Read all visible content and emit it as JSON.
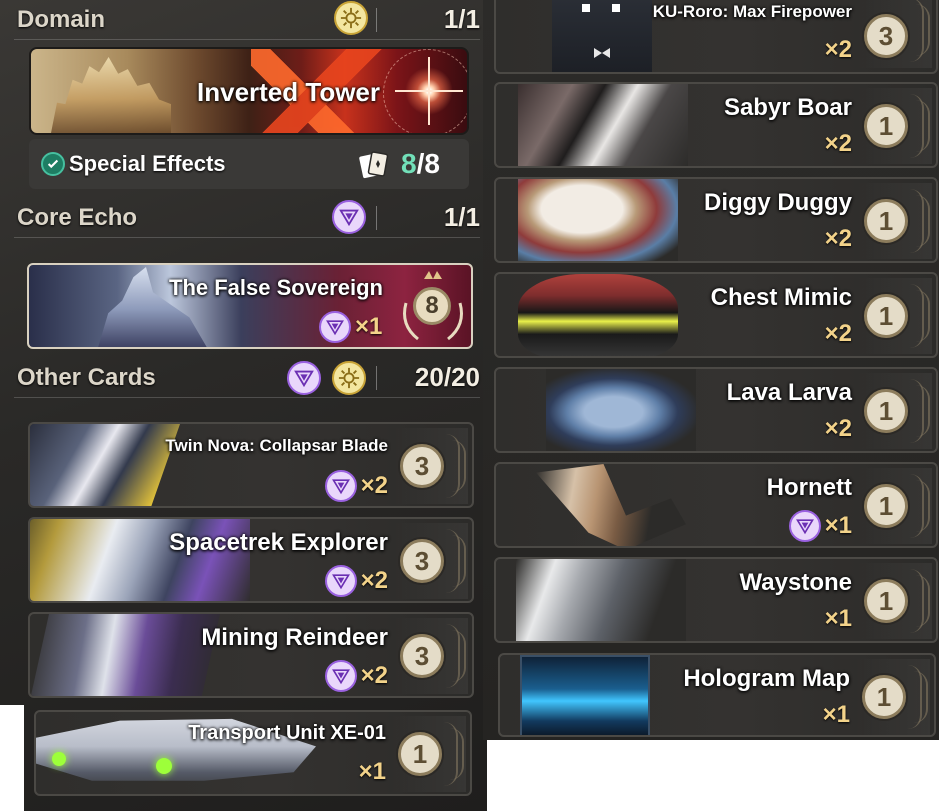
{
  "domain_section": {
    "title": "Domain",
    "count": "1/1",
    "banner_name": "Inverted Tower",
    "special_effects_label": "Special Effects",
    "special_effects_current": "8",
    "special_effects_total": "/8"
  },
  "core_echo_section": {
    "title": "Core Echo",
    "count": "1/1",
    "card": {
      "name": "The False Sovereign",
      "cost": "8",
      "quantity": "×1"
    }
  },
  "other_cards_section": {
    "title": "Other Cards",
    "count": "20/20"
  },
  "left_cards": [
    {
      "name": "Twin Nova: Collapsar Blade",
      "quantity": "×2",
      "cost": "3",
      "echo": true
    },
    {
      "name": "Spacetrek Explorer",
      "quantity": "×2",
      "cost": "3",
      "echo": true
    },
    {
      "name": "Mining Reindeer",
      "quantity": "×2",
      "cost": "3",
      "echo": true
    },
    {
      "name": "Transport Unit XE-01",
      "quantity": "×1",
      "cost": "1",
      "echo": false
    }
  ],
  "right_cards": [
    {
      "name": "KU-Roro: Max Firepower",
      "quantity": "×2",
      "cost": "3",
      "echo": false
    },
    {
      "name": "Sabyr Boar",
      "quantity": "×2",
      "cost": "1",
      "echo": false
    },
    {
      "name": "Diggy Duggy",
      "quantity": "×2",
      "cost": "1",
      "echo": false
    },
    {
      "name": "Chest Mimic",
      "quantity": "×2",
      "cost": "1",
      "echo": false
    },
    {
      "name": "Lava Larva",
      "quantity": "×2",
      "cost": "1",
      "echo": false
    },
    {
      "name": "Hornett",
      "quantity": "×1",
      "cost": "1",
      "echo": true
    },
    {
      "name": "Waystone",
      "quantity": "×1",
      "cost": "1",
      "echo": false
    },
    {
      "name": "Hologram Map",
      "quantity": "×1",
      "cost": "1",
      "echo": false
    }
  ],
  "colors": {
    "echo_purple": "#9a61e0",
    "domain_gold": "#c9a437",
    "quantity_gold": "#f3d38a",
    "effects_green": "#72e0b9"
  },
  "icons": {
    "domain_type": "sun-compass-icon",
    "echo_type": "echo-swirl-icon",
    "special_effects_check": "check-circle-icon",
    "special_effects_cards": "cards-icon"
  }
}
